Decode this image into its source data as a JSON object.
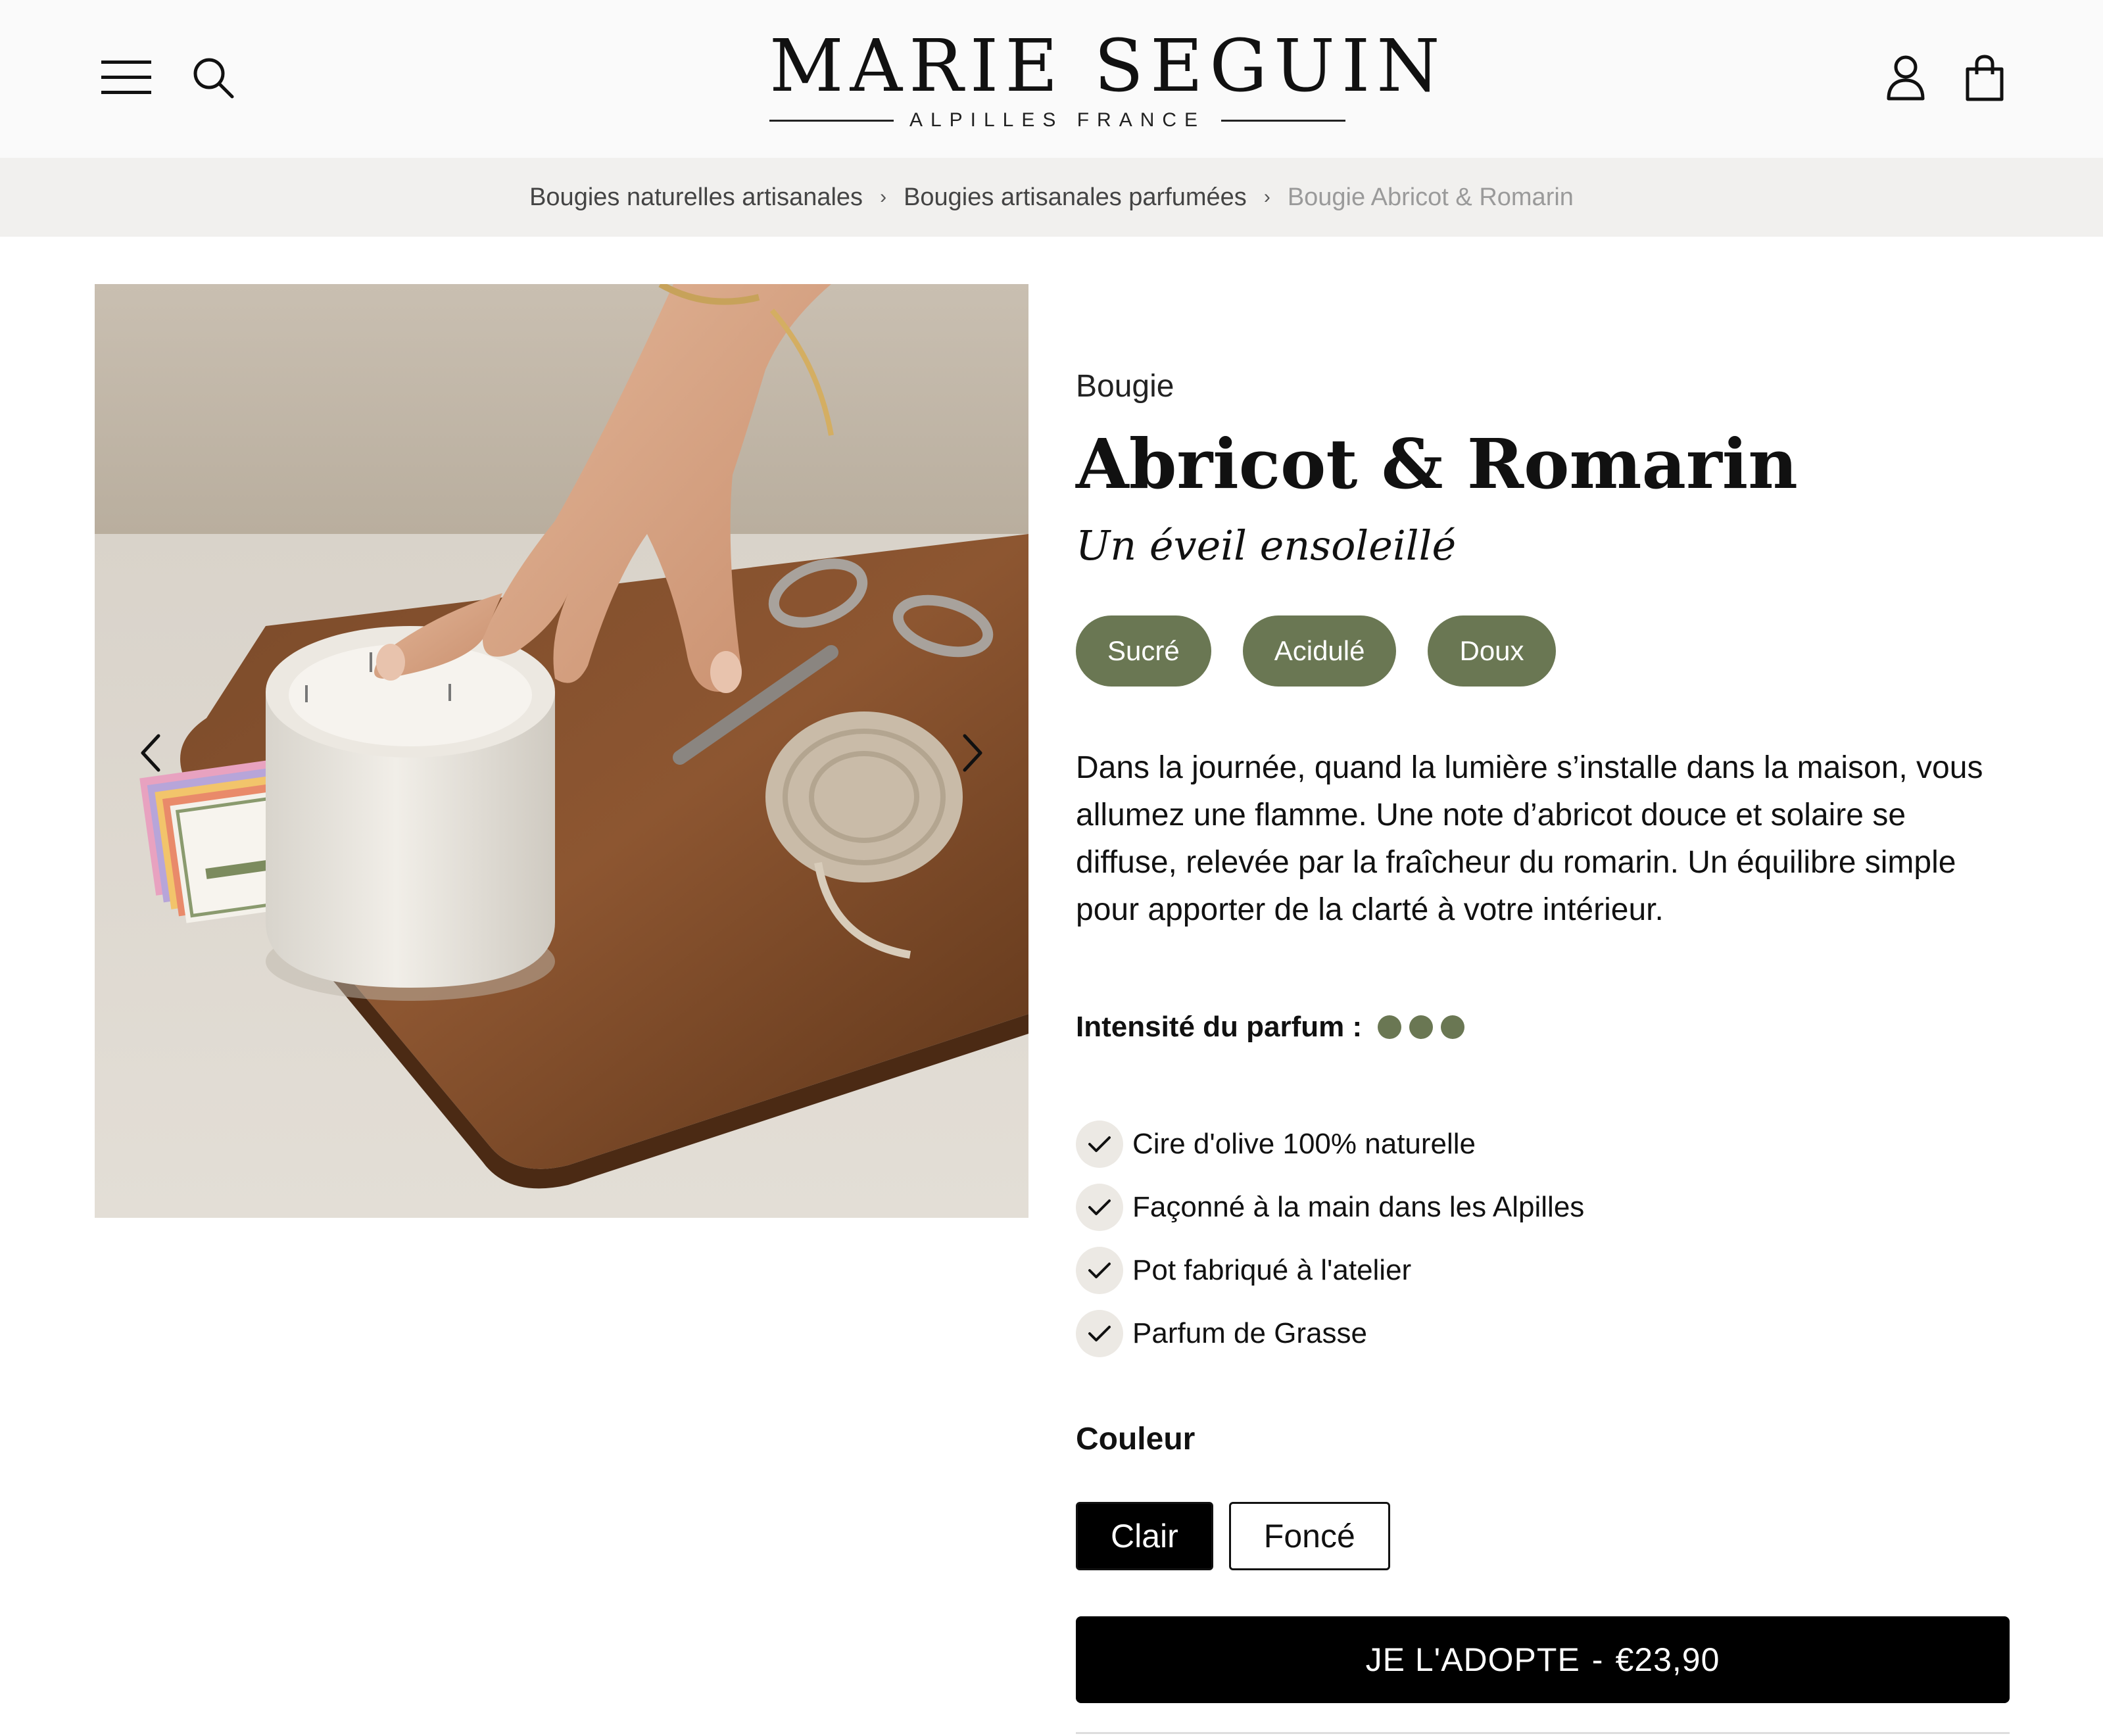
{
  "brand": {
    "name": "MARIE SEGUIN",
    "subtitle": "ALPILLES FRANCE"
  },
  "header": {
    "icons": {
      "menu": "hamburger-menu-icon",
      "search": "search-icon",
      "account": "user-icon",
      "cart": "shopping-bag-icon"
    }
  },
  "breadcrumb": {
    "items": [
      "Bougies naturelles artisanales",
      "Bougies artisanales parfumées",
      "Bougie Abricot & Romarin"
    ],
    "separator": "›"
  },
  "gallery": {
    "prev_icon": "chevron-left-icon",
    "next_icon": "chevron-right-icon"
  },
  "product": {
    "category": "Bougie",
    "title": "Abricot & Romarin",
    "tagline": "Un éveil ensoleillé",
    "tags": [
      "Sucré",
      "Acidulé",
      "Doux"
    ],
    "description": "Dans la journée, quand la lumière s’installe dans la maison, vous allumez une flamme. Une note d’abricot douce et solaire se diffuse, relevée par la fraîcheur du romarin. Un équilibre simple pour apporter de la clarté à votre intérieur.",
    "intensity_label": "Intensité du parfum :",
    "intensity_level": 3,
    "features": [
      "Cire d'olive 100% naturelle",
      "Façonné à la main dans les Alpilles",
      "Pot fabriqué à l'atelier",
      "Parfum de Grasse"
    ],
    "color_label": "Couleur",
    "colors": [
      {
        "label": "Clair",
        "selected": true
      },
      {
        "label": "Foncé",
        "selected": false
      }
    ],
    "cta_label": "JE L'ADOPTE",
    "price": "€23,90"
  },
  "colors": {
    "accent_green": "#6a7753",
    "cta_black": "#000000",
    "breadcrumb_bg": "#f1f0ee"
  }
}
